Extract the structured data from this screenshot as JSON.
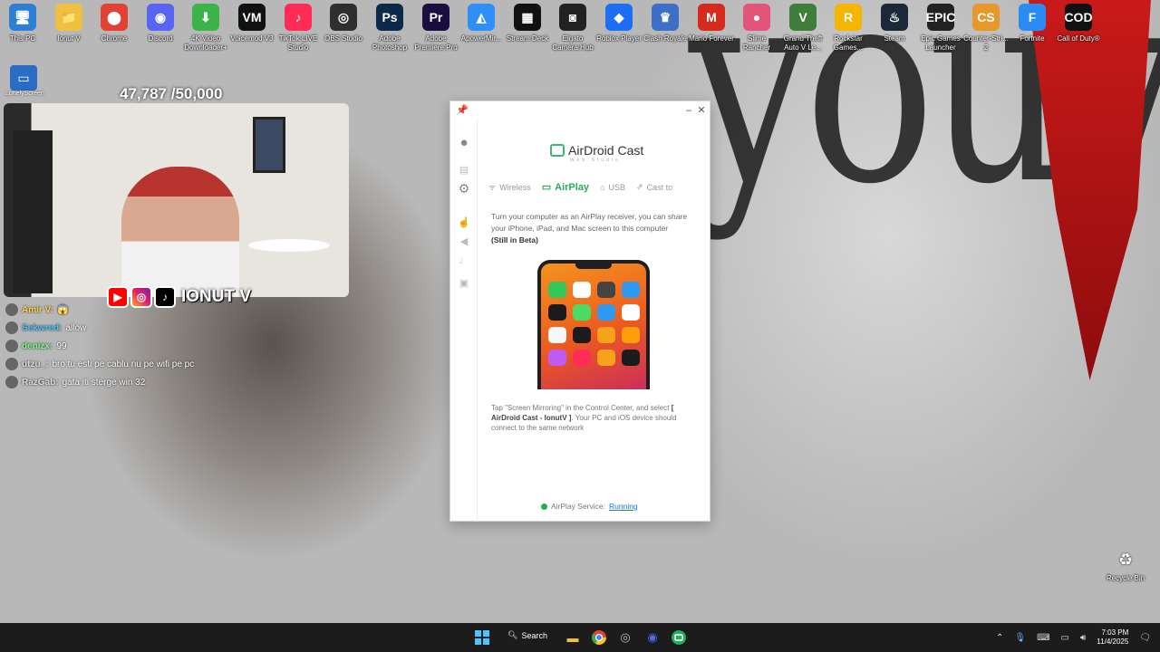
{
  "desktop_icons": [
    {
      "label": "This PC",
      "icon": "computer-icon",
      "color": "#2d7fd3"
    },
    {
      "label": "Ionut V",
      "icon": "folder-icon",
      "color": "#f0c040"
    },
    {
      "label": "Chrome",
      "icon": "chrome-icon",
      "color": "#e34133"
    },
    {
      "label": "Discord",
      "icon": "discord-icon",
      "color": "#5865f2"
    },
    {
      "label": "4K Video Downloader+",
      "icon": "video-download-icon",
      "color": "#3cb44a"
    },
    {
      "label": "Voicemod V3",
      "icon": "voicemod-icon",
      "color": "#111111"
    },
    {
      "label": "TikTok LIVE Studio",
      "icon": "tiktok-icon",
      "color": "#fe2c55"
    },
    {
      "label": "OBS Studio",
      "icon": "obs-icon",
      "color": "#302e31"
    },
    {
      "label": "Adobe Photoshop",
      "icon": "photoshop-icon",
      "color": "#0b2a4a"
    },
    {
      "label": "Adobe Premiere Pro",
      "icon": "premiere-icon",
      "color": "#1a0d3f"
    },
    {
      "label": "ApowerMir...",
      "icon": "apowermirror-icon",
      "color": "#2f8ef7"
    },
    {
      "label": "Stream Deck",
      "icon": "stream-deck-icon",
      "color": "#111111"
    },
    {
      "label": "Elgato Camera Hub",
      "icon": "camera-hub-icon",
      "color": "#222222"
    },
    {
      "label": "Roblox Player",
      "icon": "roblox-icon",
      "color": "#1e6ef5"
    },
    {
      "label": "Clash Royale",
      "icon": "clash-royale-icon",
      "color": "#3d6fc7"
    },
    {
      "label": "Mario Forever",
      "icon": "mario-icon",
      "color": "#d52b1e"
    },
    {
      "label": "Slime Rancher",
      "icon": "slime-icon",
      "color": "#e3547a"
    },
    {
      "label": "Grand Theft Auto V Le...",
      "icon": "gta-icon",
      "color": "#3f7d3b"
    },
    {
      "label": "Rockstar Games...",
      "icon": "rockstar-icon",
      "color": "#f5b600"
    },
    {
      "label": "Steam",
      "icon": "steam-icon",
      "color": "#1b2838"
    },
    {
      "label": "Epic Games Launcher",
      "icon": "epic-games-icon",
      "color": "#222222"
    },
    {
      "label": "Counter-Stri... 2",
      "icon": "counter-strike-icon",
      "color": "#e8972a"
    },
    {
      "label": "Fortnite",
      "icon": "fortnite-icon",
      "color": "#2a8bf2"
    },
    {
      "label": "Call of Duty®",
      "icon": "call-of-duty-icon",
      "color": "#111111"
    }
  ],
  "icon_glyphs": [
    "🖥",
    "📁",
    "⬤",
    "◉",
    "⬇",
    "VM",
    "♪",
    "◎",
    "Ps",
    "Pr",
    "◭",
    "▦",
    "◙",
    "◆",
    "♛",
    "M",
    "●",
    "V",
    "R",
    "♨",
    "EPIC",
    "CS",
    "F",
    "COD"
  ],
  "lonely_screen": {
    "label": "LonelyScreen"
  },
  "sub_counter": "47,787 /50,000",
  "overlay": {
    "social_name": "IONUT V"
  },
  "chat": [
    {
      "user": "Amir V:",
      "text": "😱",
      "user_color": "#ffd54a"
    },
    {
      "user": "Sekwred:",
      "text": "allow",
      "user_color": "#4fc3f7"
    },
    {
      "user": "denizx:",
      "text": "99",
      "user_color": "#7cfc8a"
    },
    {
      "user": "utzu_:",
      "text": "bro tu esti pe cablu nu pe wifi pe pc",
      "user_color": "#dddddd"
    },
    {
      "user": "RazGab:",
      "text": "gata iti sterge win 32",
      "user_color": "#dddddd"
    }
  ],
  "recycle_bin": {
    "label": "Recycle Bin"
  },
  "window": {
    "title_buttons": {
      "pin": "📌",
      "minimize": "–",
      "close": "✕"
    },
    "logo": "AirDroid Cast",
    "logo_sub": "Web Studio",
    "tabs": [
      {
        "label": "Wireless",
        "icon": "wifi-icon",
        "glyph": "ᯤ"
      },
      {
        "label": "AirPlay",
        "icon": "airplay-icon",
        "glyph": "▭"
      },
      {
        "label": "USB",
        "icon": "usb-icon",
        "glyph": "⌂"
      },
      {
        "label": "Cast to",
        "icon": "cast-icon",
        "glyph": "⇗"
      }
    ],
    "description": "Turn your computer as an AirPlay receiver, you can share your iPhone, iPad, and Mac screen to this computer",
    "beta": "(Still in Beta)",
    "instruction_pre": "Tap \"Screen Mirroring\" in the Control Center, and select",
    "device_name": "[ AirDroid Cast - IonutV ]",
    "instruction_post": ". Your PC and iOS device should connect to the same network",
    "status_label": "AirPlay Service:",
    "status_value": "Running",
    "status_color": "#23b14d",
    "accent": "#2aaa5c"
  },
  "app_colors": [
    "#34c759",
    "#ffffff",
    "#444444",
    "#2f9bf0",
    "#1c1c1e",
    "#4cd964",
    "#2f9bf0",
    "#ffffff",
    "#f7f7f7",
    "#1c1c1e",
    "#f7a21b",
    "#ff9f0a",
    "#bf5af2",
    "#ff2d55",
    "#f7a21b",
    "#1c1c1e"
  ],
  "taskbar": {
    "search_label": "Search",
    "time": "7:03 PM",
    "date": "11/4/2025"
  }
}
